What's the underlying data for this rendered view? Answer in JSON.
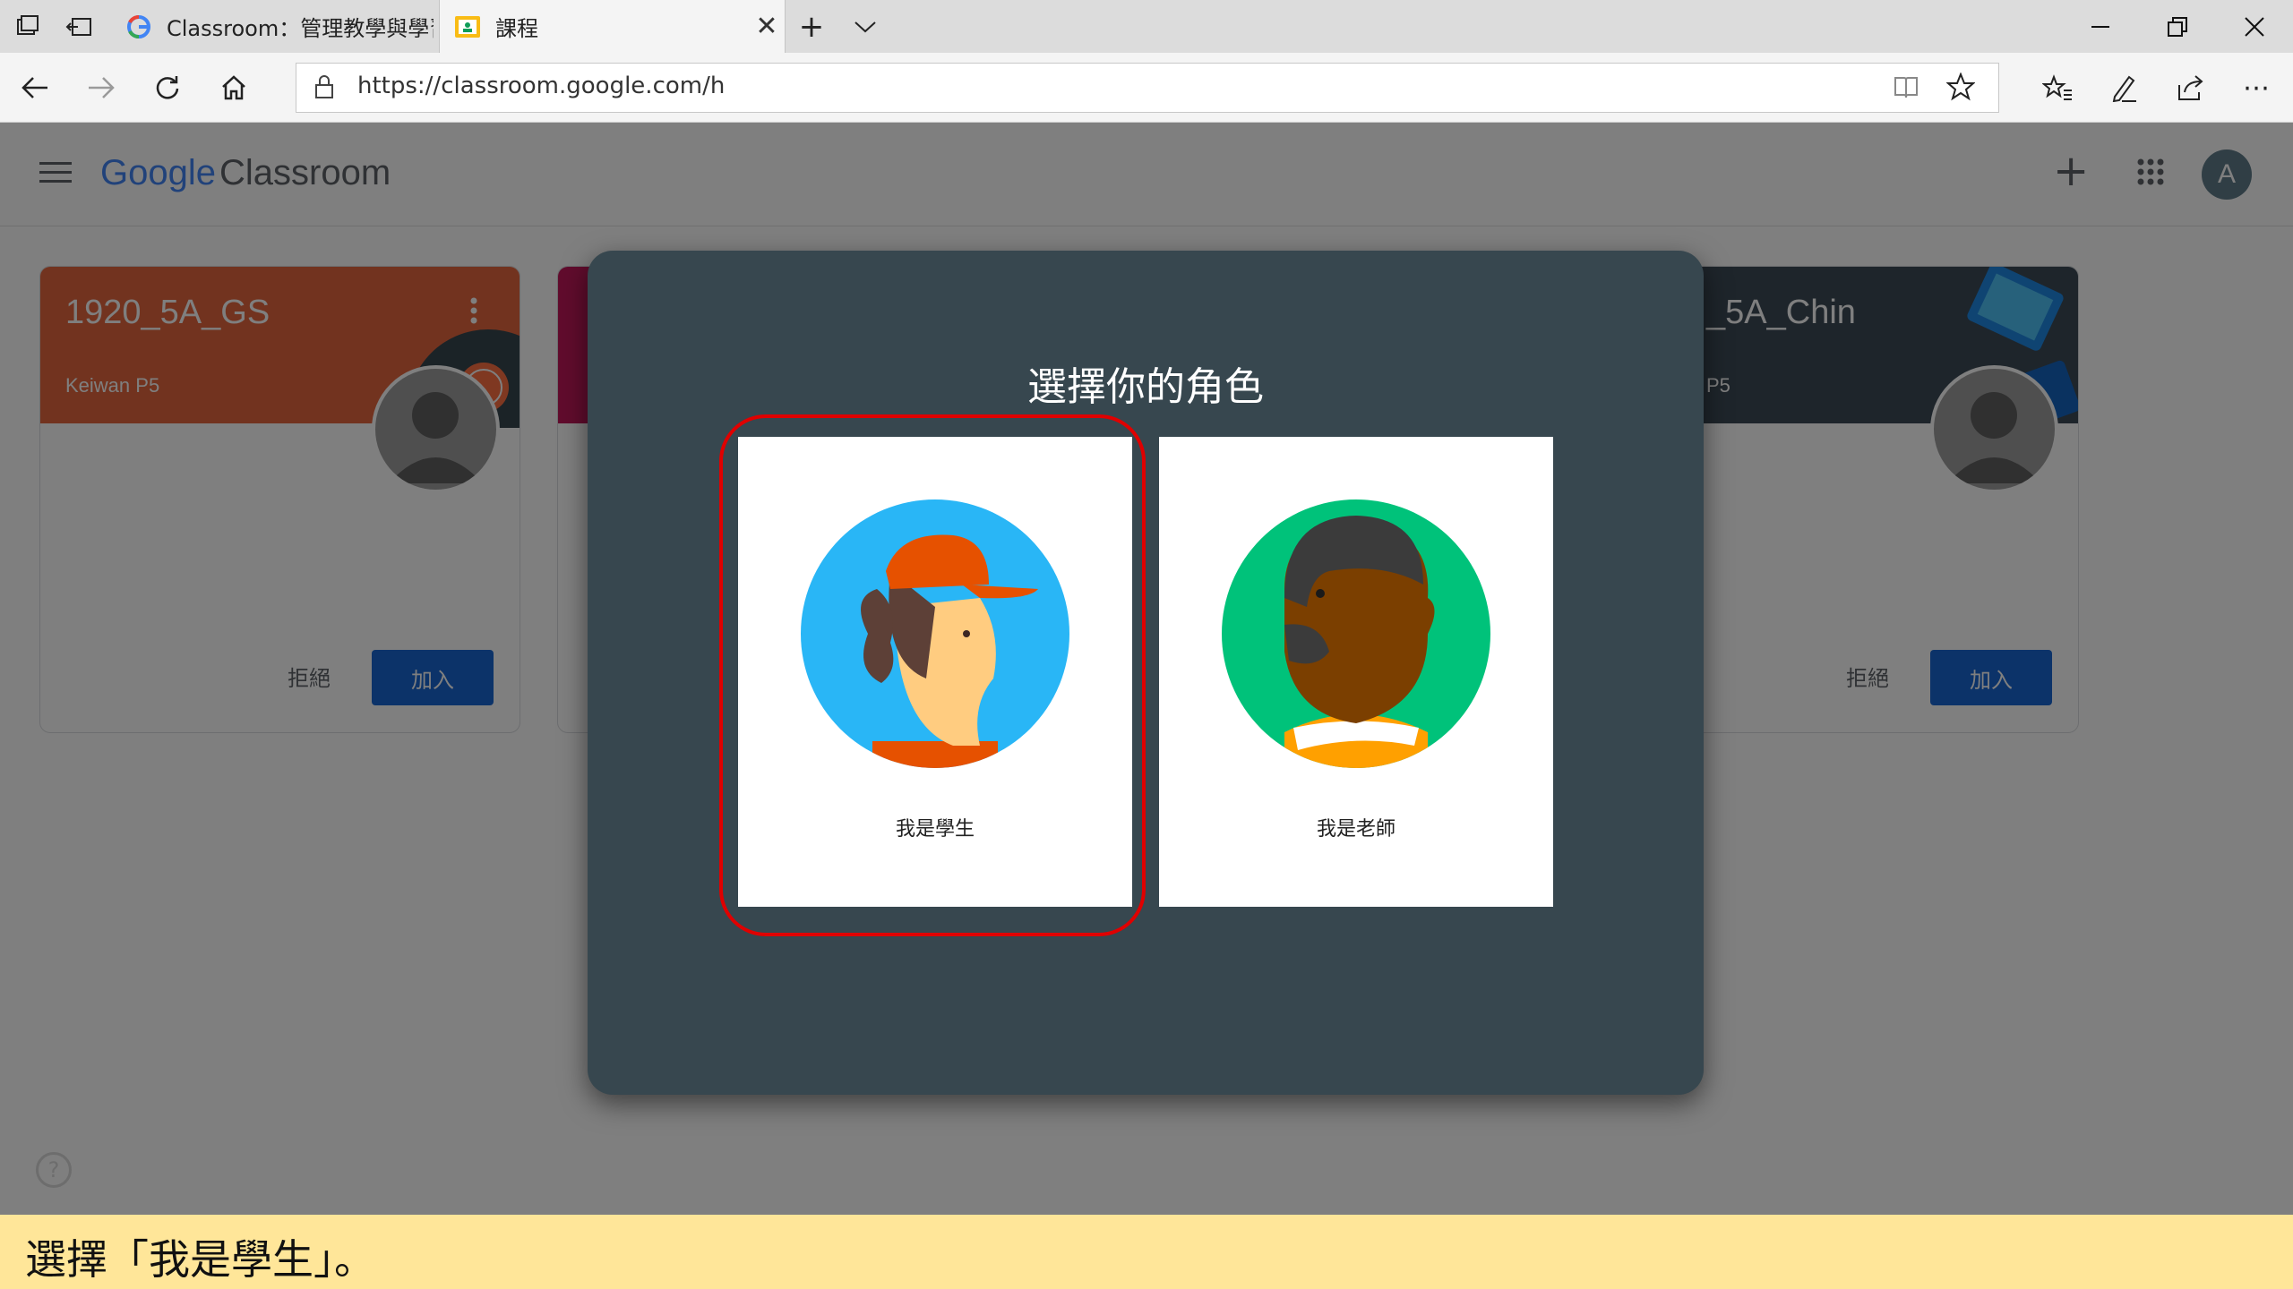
{
  "browser": {
    "tabs": [
      {
        "title": "Classroom：管理教學與學習",
        "active": false
      },
      {
        "title": "課程",
        "active": true
      }
    ],
    "url": "https://classroom.google.com/h"
  },
  "app": {
    "logo_google": "Google",
    "logo_product": "Classroom",
    "avatar_letter": "A"
  },
  "cards": [
    {
      "title": "1920_5A_GS",
      "teacher": "Keiwan P5",
      "decline_label": "拒絕",
      "join_label": "加入",
      "color": "#e4673f"
    },
    {
      "title": "",
      "teacher": "",
      "decline_label": "",
      "join_label": "",
      "color": "#c2185b"
    },
    {
      "title": "_5A_Chin",
      "teacher": "P5",
      "decline_label": "拒絕",
      "join_label": "加入",
      "color": "#3c4a56"
    }
  ],
  "dialog": {
    "title": "選擇你的角色",
    "student_label": "我是學生",
    "teacher_label": "我是老師"
  },
  "caption": "選擇「我是學生」。",
  "colors": {
    "dialog_bg": "#37474f",
    "join_button": "#1967d2",
    "highlight": "#e00000",
    "caption_bg": "#ffe699"
  }
}
